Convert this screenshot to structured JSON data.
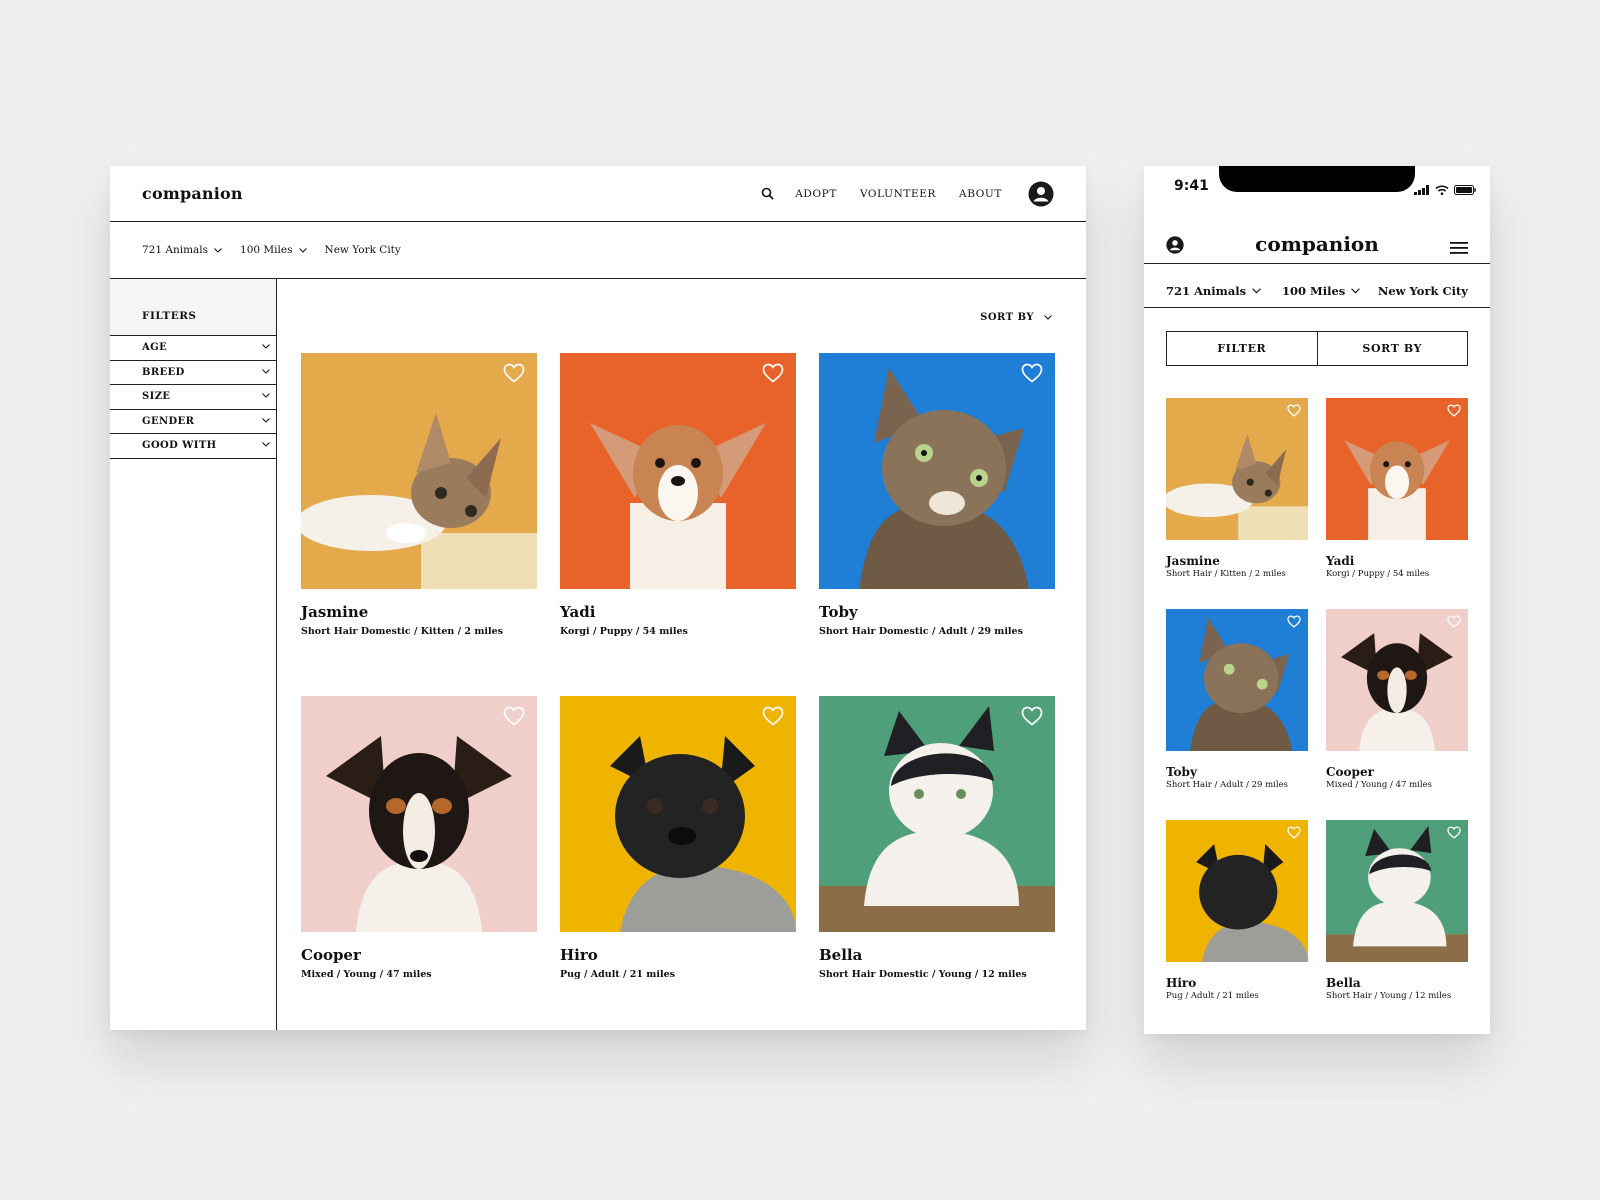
{
  "desktop": {
    "logo": "companion",
    "nav": [
      "ADOPT",
      "VOLUNTEER",
      "ABOUT"
    ],
    "subbar": {
      "animals": "721 Animals",
      "miles": "100 Miles",
      "city": "New York City"
    },
    "filters_title": "FILTERS",
    "filters": [
      "AGE",
      "BREED",
      "SIZE",
      "GENDER",
      "GOOD WITH"
    ],
    "sort_label": "SORT BY",
    "pets": [
      {
        "name": "Jasmine",
        "meta": "Short Hair Domestic  /  Kitten  /  2 miles"
      },
      {
        "name": "Yadi",
        "meta": "Korgi  /  Puppy  /  54 miles"
      },
      {
        "name": "Toby",
        "meta": "Short Hair Domestic  /  Adult  /  29 miles"
      },
      {
        "name": "Cooper",
        "meta": "Mixed  /  Young  /  47 miles"
      },
      {
        "name": "Hiro",
        "meta": "Pug  /  Adult  /  21 miles"
      },
      {
        "name": "Bella",
        "meta": "Short Hair Domestic  /  Young  /  12 miles"
      }
    ]
  },
  "mobile": {
    "time": "9:41",
    "logo": "companion",
    "subbar": {
      "animals": "721 Animals",
      "miles": "100 Miles",
      "city": "New York City"
    },
    "filter_button": "FILTER",
    "sort_button": "SORT BY",
    "pets": [
      {
        "name": "Jasmine",
        "meta": "Short Hair  /  Kitten  /  2 miles"
      },
      {
        "name": "Yadi",
        "meta": "Korgi  /  Puppy  /  54 miles"
      },
      {
        "name": "Toby",
        "meta": "Short Hair  /  Adult  /  29 miles"
      },
      {
        "name": "Cooper",
        "meta": "Mixed  /  Young  /  47 miles"
      },
      {
        "name": "Hiro",
        "meta": "Pug  /  Adult  /  21 miles"
      },
      {
        "name": "Bella",
        "meta": "Short Hair / Young / 12 miles"
      }
    ]
  },
  "colors": {
    "jasmine_bg": "#e3a94a",
    "yadi_bg": "#e7632a",
    "toby_bg": "#1f7fd6",
    "cooper_bg": "#f0cfcb",
    "hiro_bg": "#efb400",
    "bella_bg": "#4fa07a"
  }
}
